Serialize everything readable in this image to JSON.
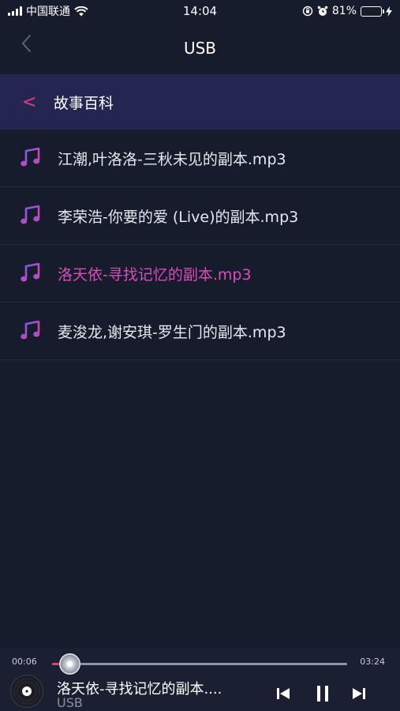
{
  "status_bar": {
    "carrier": "中国联通",
    "time": "14:04",
    "battery": "81%",
    "battery_level": 0.81,
    "battery_color": "#4cd964"
  },
  "nav": {
    "back_icon": "chevron-left-icon",
    "title": "USB"
  },
  "folder": {
    "back_glyph": "<",
    "title": "故事百科"
  },
  "files": [
    {
      "name": "江潮,叶洛洛-三秋未见的副本.mp3",
      "icon": "music-note-icon",
      "active": false
    },
    {
      "name": "李荣浩-你要的爱 (Live)的副本.mp3",
      "icon": "music-note-icon",
      "active": false
    },
    {
      "name": "洛天依-寻找记忆的副本.mp3",
      "icon": "music-note-icon",
      "active": true
    },
    {
      "name": "麦浚龙,谢安琪-罗生门的副本.mp3",
      "icon": "music-note-icon",
      "active": false
    }
  ],
  "player": {
    "current_time": "00:06",
    "total_time": "03:24",
    "progress": 0.06,
    "now_playing_title": "洛天依-寻找记忆的副本....",
    "source": "USB",
    "controls": [
      "previous-icon",
      "pause-icon",
      "next-icon"
    ]
  },
  "colors": {
    "accent": "#e0407c",
    "active_text": "#d84cba",
    "background": "#171c2c",
    "folder_bar": "#242550"
  }
}
